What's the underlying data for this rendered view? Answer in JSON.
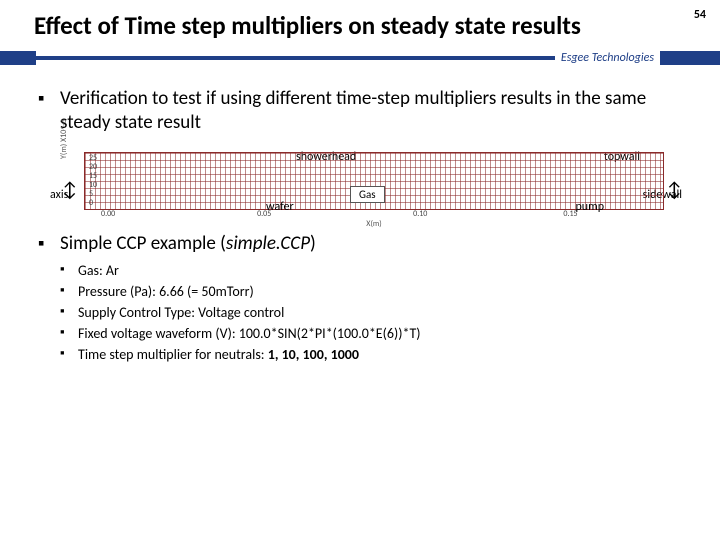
{
  "slide_number": "54",
  "title": "Effect of Time step multipliers on steady state results",
  "brand": "Esgee Technologies",
  "bullets": {
    "b1": "Verification to test if using different time-step multipliers results in the same steady state result",
    "b2_prefix": "Simple CCP example (",
    "b2_italic": "simple.CCP",
    "b2_suffix": ")"
  },
  "sub": {
    "s1": "Gas: Ar",
    "s2": "Pressure (Pa): 6.66  (= 50mTorr)",
    "s3": "Supply Control Type: Voltage control",
    "s4": "Fixed voltage waveform (V): 100.0*SIN(2*PI*(100.0*E(6))*T)",
    "s5_prefix": "Time step multiplier for neutrals: ",
    "s5_bold": "1, 10, 100, 1000"
  },
  "diagram": {
    "showerhead": "showerhead",
    "topwall": "topwall",
    "axis": "axis",
    "sidewall": "sidewall",
    "wafer": "wafer",
    "pump": "pump",
    "gas": "Gas",
    "yticks": [
      "25",
      "20",
      "15",
      "10",
      "5",
      "0"
    ],
    "xticks": [
      "0.00",
      "0.05",
      "0.10",
      "0.15"
    ],
    "xcap": "X(m)",
    "ycap": "Y(m) X10^-3"
  }
}
